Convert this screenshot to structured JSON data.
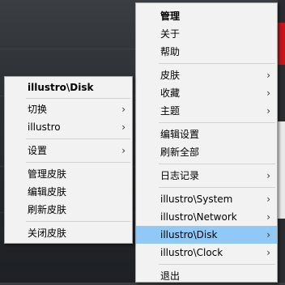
{
  "main_menu": {
    "items": [
      {
        "label": "管理",
        "bold": true,
        "arrow": false
      },
      {
        "label": "关于",
        "arrow": false
      },
      {
        "label": "帮助",
        "arrow": false
      },
      {
        "label": "皮肤",
        "arrow": true
      },
      {
        "label": "收藏",
        "arrow": true
      },
      {
        "label": "主题",
        "arrow": true
      },
      {
        "label": "编辑设置",
        "arrow": false
      },
      {
        "label": "刷新全部",
        "arrow": false
      },
      {
        "label": "日志记录",
        "arrow": true
      },
      {
        "label": "illustro\\System",
        "arrow": true
      },
      {
        "label": "illustro\\Network",
        "arrow": true
      },
      {
        "label": "illustro\\Disk",
        "arrow": true,
        "highlighted": true
      },
      {
        "label": "illustro\\Clock",
        "arrow": true
      },
      {
        "label": "退出",
        "arrow": false
      }
    ],
    "arrow_glyph": "›"
  },
  "sub_menu": {
    "title": "illustro\\Disk",
    "items": [
      {
        "label": "切换",
        "arrow": true
      },
      {
        "label": "illustro",
        "arrow": true
      },
      {
        "label": "设置",
        "arrow": true
      },
      {
        "label": "管理皮肤",
        "arrow": false
      },
      {
        "label": "编辑皮肤",
        "arrow": false
      },
      {
        "label": "刷新皮肤",
        "arrow": false
      },
      {
        "label": "关闭皮肤",
        "arrow": false
      }
    ],
    "arrow_glyph": "›"
  },
  "colors": {
    "menu_bg": "#f2f2f2",
    "highlight": "#90c8f6",
    "separator": "#d2d2d2"
  }
}
